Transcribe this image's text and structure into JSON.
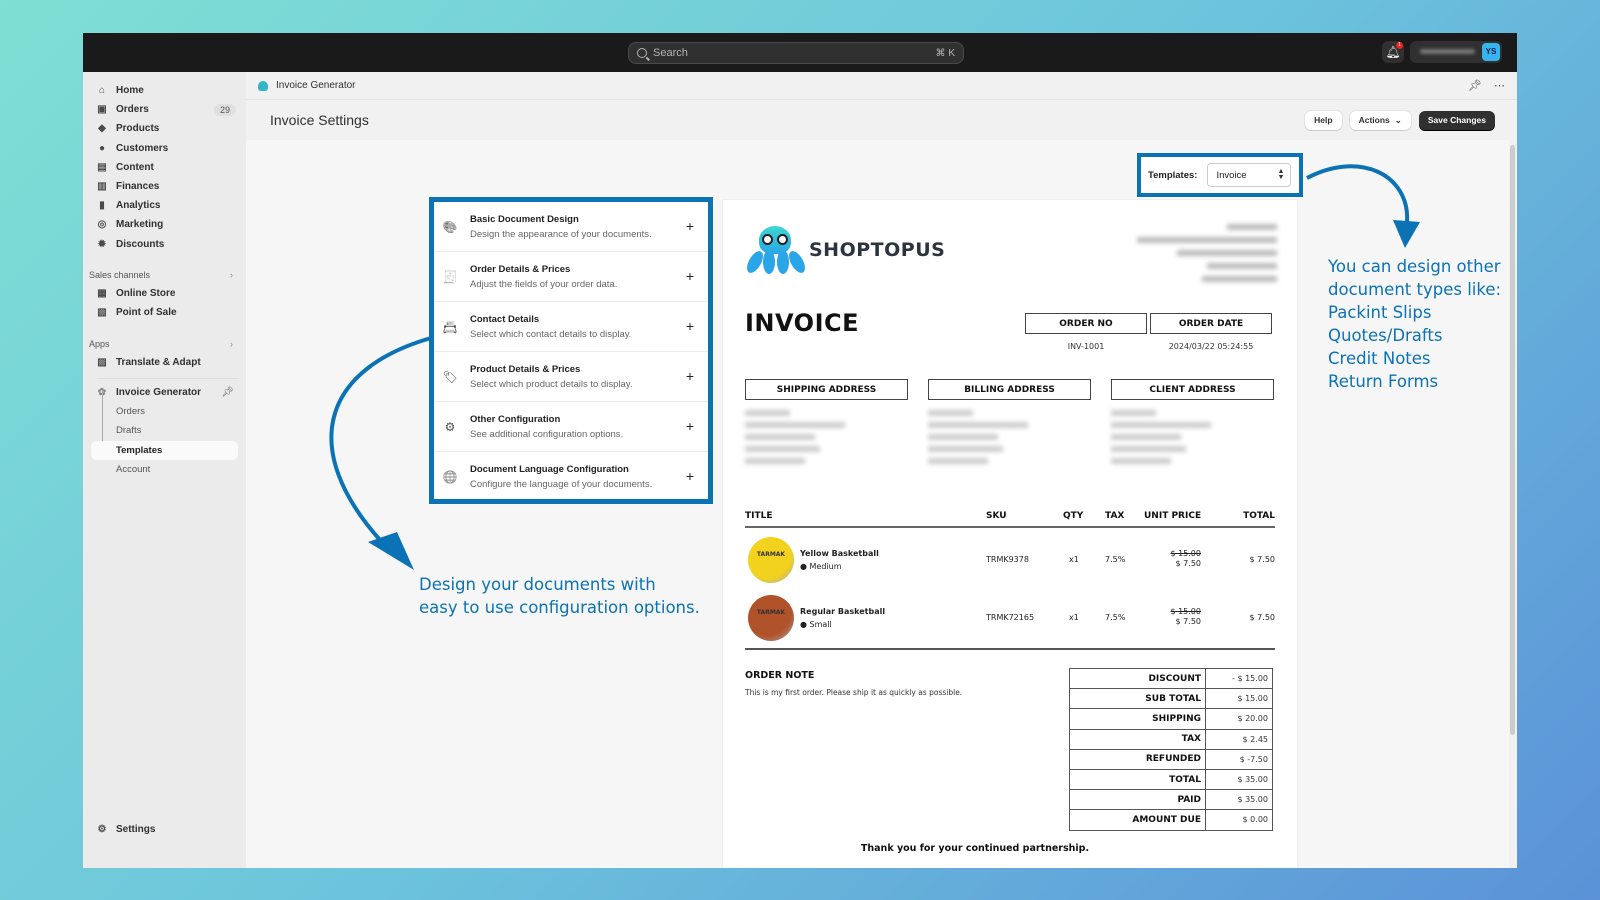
{
  "topbar": {
    "search_placeholder": "Search",
    "search_shortcut": "⌘ K",
    "notification_count": "1",
    "avatar_initials": "YS"
  },
  "sidebar": {
    "items": [
      {
        "label": "Home",
        "icon": "home-icon",
        "glyph": "⌂"
      },
      {
        "label": "Orders",
        "icon": "inbox-icon",
        "glyph": "▣",
        "badge": "29"
      },
      {
        "label": "Products",
        "icon": "tag-icon",
        "glyph": "◆"
      },
      {
        "label": "Customers",
        "icon": "person-icon",
        "glyph": "●"
      },
      {
        "label": "Content",
        "icon": "image-icon",
        "glyph": "▤"
      },
      {
        "label": "Finances",
        "icon": "bank-icon",
        "glyph": "▥"
      },
      {
        "label": "Analytics",
        "icon": "bar-chart-icon",
        "glyph": "▮"
      },
      {
        "label": "Marketing",
        "icon": "target-icon",
        "glyph": "◎"
      },
      {
        "label": "Discounts",
        "icon": "discount-icon",
        "glyph": "✹"
      }
    ],
    "sales_channels": {
      "label": "Sales channels",
      "items": [
        {
          "label": "Online Store",
          "icon": "store-icon",
          "glyph": "▦"
        },
        {
          "label": "Point of Sale",
          "icon": "pos-icon",
          "glyph": "▧"
        }
      ]
    },
    "apps": {
      "label": "Apps",
      "items": [
        {
          "label": "Translate & Adapt",
          "icon": "translate-icon",
          "glyph": "▨"
        }
      ]
    },
    "app": {
      "label": "Invoice Generator",
      "sub_items": [
        {
          "label": "Orders"
        },
        {
          "label": "Drafts"
        },
        {
          "label": "Templates",
          "active": true
        },
        {
          "label": "Account"
        }
      ]
    },
    "settings_label": "Settings"
  },
  "appbar": {
    "title": "Invoice Generator"
  },
  "header": {
    "title": "Invoice Settings",
    "help_label": "Help",
    "actions_label": "Actions",
    "save_label": "Save Changes"
  },
  "config": {
    "sections": [
      {
        "title": "Basic Document Design",
        "desc": "Design the appearance of your documents.",
        "glyph": "🎨"
      },
      {
        "title": "Order Details & Prices",
        "desc": "Adjust the fields of your order data.",
        "glyph": "🧾"
      },
      {
        "title": "Contact Details",
        "desc": "Select which contact details to display.",
        "glyph": "📇"
      },
      {
        "title": "Product Details & Prices",
        "desc": "Select which product details to display.",
        "glyph": "🏷"
      },
      {
        "title": "Other Configuration",
        "desc": "See additional configuration options.",
        "glyph": "⚙"
      },
      {
        "title": "Document Language Configuration",
        "desc": "Configure the language of your documents.",
        "glyph": "🌐"
      }
    ]
  },
  "templates": {
    "label": "Templates:",
    "selected": "Invoice"
  },
  "invoice": {
    "brand": "SHOPTOPUS",
    "title": "INVOICE",
    "order_no_label": "ORDER NO",
    "order_no": "INV-1001",
    "order_date_label": "ORDER DATE",
    "order_date": "2024/03/22 05:24:55",
    "shipping_address_label": "SHIPPING ADDRESS",
    "billing_address_label": "BILLING ADDRESS",
    "client_address_label": "CLIENT ADDRESS",
    "columns": {
      "title": "TITLE",
      "sku": "SKU",
      "qty": "QTY",
      "tax": "TAX",
      "unit_price": "UNIT PRICE",
      "total": "TOTAL"
    },
    "items": [
      {
        "name": "Yellow Basketball",
        "variant": "● Medium",
        "image_label": "TARMAK",
        "color": "#f3d21d",
        "sku": "TRMK9378",
        "qty": "x1",
        "tax": "7.5%",
        "original_price": "$ 15.00",
        "unit_price": "$ 7.50",
        "total": "$ 7.50"
      },
      {
        "name": "Regular Basketball",
        "variant": "● Small",
        "image_label": "TARMAK",
        "color": "#b0522a",
        "sku": "TRMK72165",
        "qty": "x1",
        "tax": "7.5%",
        "original_price": "$ 15.00",
        "unit_price": "$ 7.50",
        "total": "$ 7.50"
      }
    ],
    "order_note_label": "ORDER NOTE",
    "order_note": "This is my first order. Please ship it as quickly as possible.",
    "totals": [
      {
        "label": "DISCOUNT",
        "value": "- $ 15.00"
      },
      {
        "label": "SUB TOTAL",
        "value": "$ 15.00"
      },
      {
        "label": "SHIPPING",
        "value": "$ 20.00"
      },
      {
        "label": "TAX",
        "value": "$ 2.45"
      },
      {
        "label": "REFUNDED",
        "value": "$ -7.50"
      },
      {
        "label": "TOTAL",
        "value": "$ 35.00"
      },
      {
        "label": "PAID",
        "value": "$ 35.00"
      },
      {
        "label": "AMOUNT DUE",
        "value": "$ 0.00"
      }
    ],
    "thanks": "Thank you for your continued partnership."
  },
  "annotations": {
    "left": [
      "Design your documents with",
      "easy to use configuration options."
    ],
    "right": [
      "You can design other",
      "document types like:",
      "Packint Slips",
      "Quotes/Drafts",
      "Credit Notes",
      "Return Forms"
    ],
    "color": "#0b72b5"
  }
}
